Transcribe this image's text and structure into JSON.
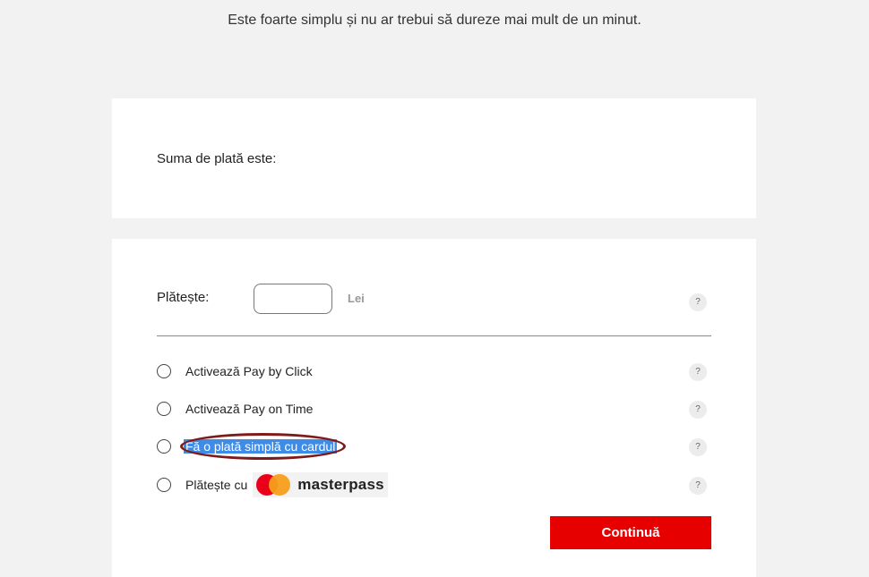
{
  "intro": "Este foarte simplu și nu ar trebui să dureze mai mult de un minut.",
  "amount_card": {
    "label": "Suma de plată este:"
  },
  "pay_card": {
    "label": "Plătește:",
    "amount_value": "",
    "currency": "Lei",
    "help_symbol": "?",
    "options": [
      {
        "label": "Activează Pay by Click",
        "selected": false
      },
      {
        "label": "Activează Pay on Time",
        "selected": false
      },
      {
        "label": "Fă o plată simplă cu cardul",
        "selected": false,
        "highlighted": true
      },
      {
        "label": "Plătește cu",
        "selected": false,
        "brand_text": "masterpass",
        "brand_icon": "mastercard-logo"
      }
    ],
    "continue_label": "Continuă"
  },
  "colors": {
    "accent": "#e60000",
    "page_bg": "#f2f2f2",
    "selection": "#3e8be8",
    "annotation_ring": "#7e1a1a"
  }
}
